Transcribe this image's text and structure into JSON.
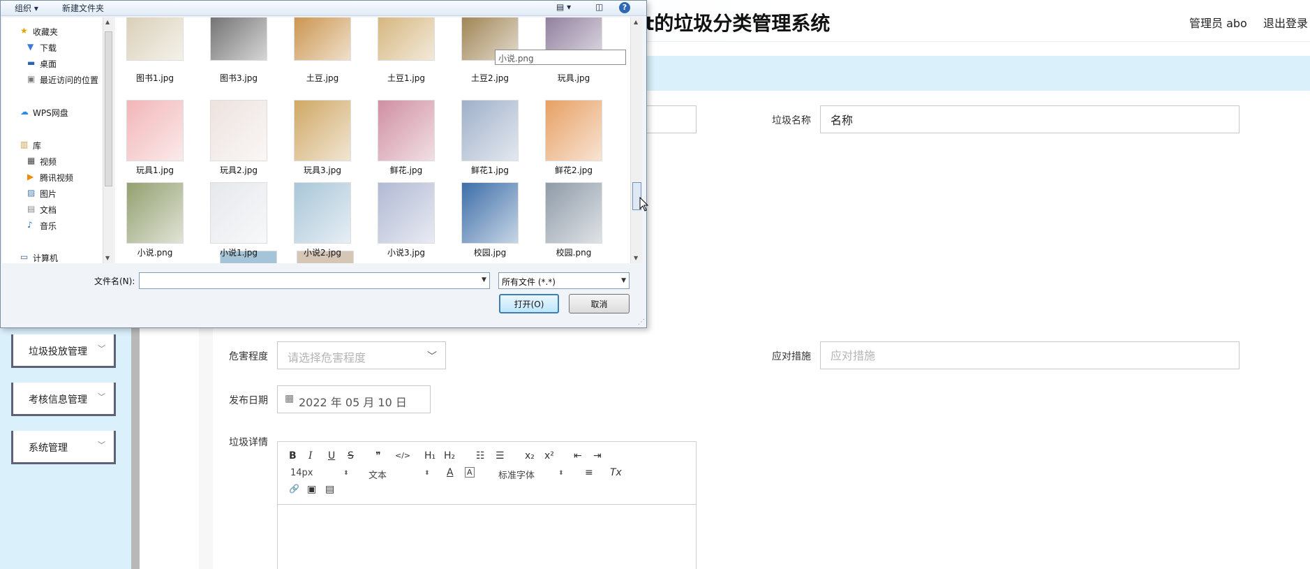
{
  "app": {
    "title": "t的垃圾分类管理系统",
    "user": "管理员 abo",
    "logout": "退出登录"
  },
  "sidebar": {
    "items": [
      {
        "label": "垃圾投放管理"
      },
      {
        "label": "考核信息管理"
      },
      {
        "label": "系统管理"
      }
    ]
  },
  "form": {
    "name_label": "垃圾名称",
    "name_value": "名称",
    "hazard_label": "危害程度",
    "hazard_placeholder": "请选择危害程度",
    "measure_label": "应对措施",
    "measure_placeholder": "应对措施",
    "date_label": "发布日期",
    "date_value": "2022 年 05 月 10 日",
    "detail_label": "垃圾详情"
  },
  "editor": {
    "font_size": "14px",
    "text_style": "文本",
    "font_family": "标准字体",
    "buttons": {
      "bold": "B",
      "italic": "I",
      "underline": "U",
      "strike": "S",
      "quote": "❞",
      "code": "</>",
      "h1": "H₁",
      "h2": "H₂",
      "ordered_list": "☷",
      "bullet_list": "☰",
      "subscript": "x₂",
      "superscript": "x²",
      "outdent": "⇤",
      "indent": "⇥",
      "text_color": "A",
      "bg_color": "A",
      "align": "≡",
      "clear_format": "Tx",
      "link": "🔗",
      "image": "▣",
      "video": "▤"
    }
  },
  "dialog": {
    "toolbar": {
      "organize": "组织 ▾",
      "new_folder": "新建文件夹",
      "help": "?"
    },
    "tree": {
      "favorites": "收藏夹",
      "downloads": "下载",
      "desktop": "桌面",
      "recent": "最近访问的位置",
      "wps": "WPS网盘",
      "library": "库",
      "videos": "视频",
      "tencent_video": "腾讯视频",
      "pictures": "图片",
      "documents": "文档",
      "music": "音乐",
      "computer": "计算机"
    },
    "files": [
      {
        "name": "图书1.jpg",
        "color": "#d9cfb6"
      },
      {
        "name": "图书3.jpg",
        "color": "#6f6f6f"
      },
      {
        "name": "土豆.jpg",
        "color": "#c9924a"
      },
      {
        "name": "土豆1.jpg",
        "color": "#d4b47c"
      },
      {
        "name": "土豆2.jpg",
        "color": "#9d8150"
      },
      {
        "name": "玩具.jpg",
        "color": "#8d7c9b"
      },
      {
        "name": "玩具1.jpg",
        "color": "#f2b6b8"
      },
      {
        "name": "玩具2.jpg",
        "color": "#ede3df"
      },
      {
        "name": "玩具3.jpg",
        "color": "#cfa865"
      },
      {
        "name": "鲜花.jpg",
        "color": "#cf8fa2"
      },
      {
        "name": "鲜花1.jpg",
        "color": "#9fb0c9"
      },
      {
        "name": "鲜花2.jpg",
        "color": "#e7a064"
      },
      {
        "name": "小说.png",
        "color": "#93a070"
      },
      {
        "name": "小说1.jpg",
        "color": "#e6e8ec"
      },
      {
        "name": "小说2.jpg",
        "color": "#a9c6d9"
      },
      {
        "name": "小说3.jpg",
        "color": "#b1b9d4"
      },
      {
        "name": "校园.jpg",
        "color": "#3d6ea8"
      },
      {
        "name": "校园.png",
        "color": "#8f9ba8"
      }
    ],
    "partial_thumb_colors": [
      "#a5c4d8",
      "#d6c6b6"
    ],
    "tooltip": "小说.png",
    "filename_label": "文件名(N):",
    "filename_value": "",
    "filetype": "所有文件 (*.*)",
    "open": "打开(O)",
    "cancel": "取消"
  }
}
